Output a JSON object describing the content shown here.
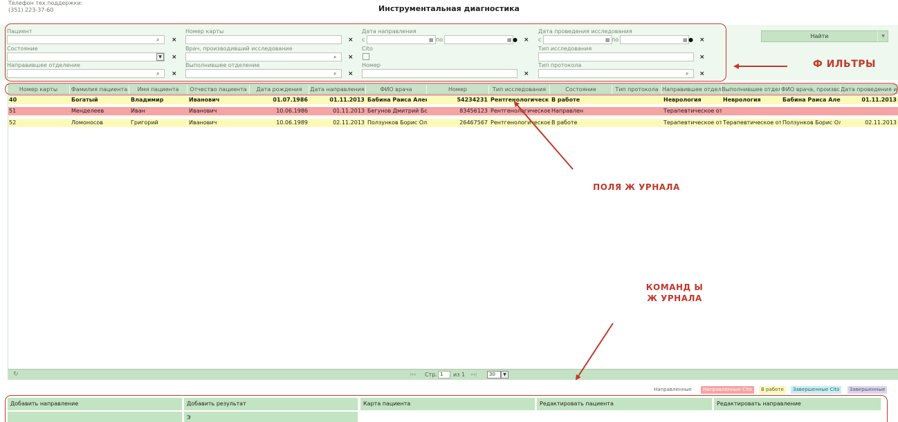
{
  "header": {
    "support_label": "Телефон тех.поддержки:",
    "support_phone": "(351) 223-37-60",
    "title": "Инструментальная диагностика"
  },
  "filters": {
    "patient": "Пациент",
    "card_number": "Номер карты",
    "referral_date": "Дата направления",
    "exam_date": "Дата проведения исследования",
    "from": "с",
    "to": "по",
    "state": "Состояние",
    "doctor": "Врач, производивший исследование",
    "cito": "Cito",
    "exam_type": "Тип исследования",
    "ref_department": "Направившее отделение",
    "exec_department": "Выполнившее отделение",
    "number": "Номер",
    "protocol_type": "Тип протокола",
    "find_button": "Найти"
  },
  "annotations": {
    "filters": "Ф ИЛЬТРЫ",
    "journal_fields": "ПОЛЯ Ж УРНАЛА",
    "journal_commands_1": "КОМАНД Ы",
    "journal_commands_2": "Ж УРНАЛА"
  },
  "grid": {
    "columns": [
      "Номер карты",
      "Фамилия пациента",
      "Имя пациента",
      "Отчество пациента",
      "Дата рождения",
      "Дата направления",
      "ФИО врача",
      "Номер",
      "Тип исследования",
      "Состояние",
      "Тип протокола",
      "Направившее отдел",
      "Выполнившее отдел",
      "ФИО врача, произвс",
      "Дата проведения ис"
    ],
    "rows": [
      {
        "card": "40",
        "last": "Богатый",
        "first": "Владимир",
        "middle": "Иванович",
        "birth": "01.07.1986",
        "ref_date": "01.11.2013",
        "doctor": "Бабина Раиса Алек",
        "number": "54234231",
        "type": "Рентгенологическ",
        "state": "В работе",
        "protocol": "",
        "ref_dep": "Неврология",
        "exec_dep": "Неврология",
        "exec_doctor": "Бабина Раиса Алек",
        "exam_date": "01.11.2013"
      },
      {
        "card": "51",
        "last": "Менделеев",
        "first": "Иван",
        "middle": "Иванович",
        "birth": "10.06.1986",
        "ref_date": "01.11.2013",
        "doctor": "Бегунов Дмитрий Бор",
        "number": "83456123",
        "type": "Рентгенологическое",
        "state": "Направлен",
        "protocol": "",
        "ref_dep": "Терапевтическое отд",
        "exec_dep": "",
        "exec_doctor": "",
        "exam_date": ""
      },
      {
        "card": "52",
        "last": "Ломоносов",
        "first": "Григорий",
        "middle": "Иванович",
        "birth": "10.06.1989",
        "ref_date": "02.11.2013",
        "doctor": "Ползунков Борис Ол",
        "number": "26467567",
        "type": "Рентгенологическое",
        "state": "В работе",
        "protocol": "",
        "ref_dep": "Терапевтическое отд",
        "exec_dep": "Терапевтическое отд",
        "exec_doctor": "Ползунков Борис Ол",
        "exam_date": "02.11.2013"
      }
    ]
  },
  "pager": {
    "page_label": "Стр.",
    "page": "1",
    "of_label": "из 1",
    "page_size": "30"
  },
  "legend": {
    "referred": "Направленные",
    "referred_cito": "Направленные Cito",
    "in_progress": "В работе",
    "done_cito": "Завершенные Cito",
    "done": "Завершенные"
  },
  "commands": {
    "add_referral": "Добавить направление",
    "add_result": "Добавить результат",
    "patient_card": "Карта пациента",
    "edit_patient": "Редактировать пациента",
    "edit_referral": "Редактировать направление",
    "partial_label": "Э"
  },
  "colors": {
    "accent_red": "#c0392b",
    "row_yellow": "#fbfab8",
    "row_red": "#f5a3a3",
    "panel_green": "#eef8ee",
    "header_green": "#c9e2c7"
  }
}
